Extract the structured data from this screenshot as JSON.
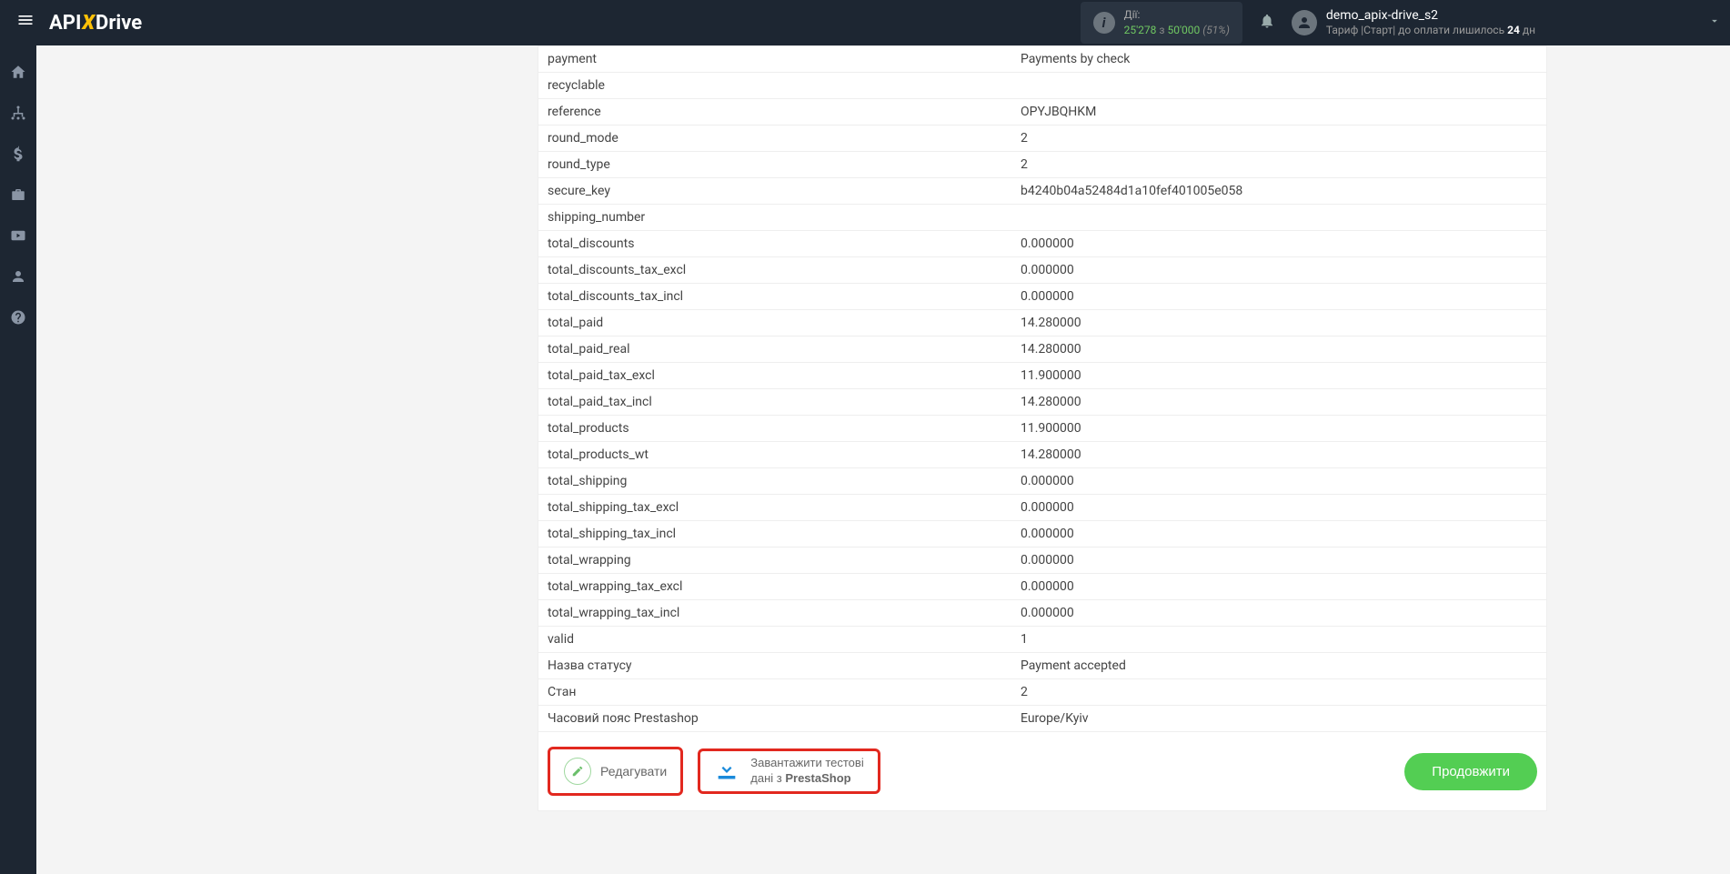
{
  "header": {
    "logo_part1": "API",
    "logo_x": "X",
    "logo_part2": "Drive",
    "stats": {
      "label": "Дії:",
      "used": "25'278",
      "sep": " з ",
      "total": "50'000",
      "pct": " (51%)"
    },
    "user": {
      "name": "demo_apix-drive_s2",
      "tariff_prefix": "Тариф |Старт| до оплати лишилось ",
      "days": "24",
      "tariff_suffix": " дн"
    }
  },
  "rows": [
    {
      "key": "payment",
      "value": "Payments by check"
    },
    {
      "key": "recyclable",
      "value": ""
    },
    {
      "key": "reference",
      "value": "OPYJBQHKM"
    },
    {
      "key": "round_mode",
      "value": "2"
    },
    {
      "key": "round_type",
      "value": "2"
    },
    {
      "key": "secure_key",
      "value": "b4240b04a52484d1a10fef401005e058"
    },
    {
      "key": "shipping_number",
      "value": ""
    },
    {
      "key": "total_discounts",
      "value": "0.000000"
    },
    {
      "key": "total_discounts_tax_excl",
      "value": "0.000000"
    },
    {
      "key": "total_discounts_tax_incl",
      "value": "0.000000"
    },
    {
      "key": "total_paid",
      "value": "14.280000"
    },
    {
      "key": "total_paid_real",
      "value": "14.280000"
    },
    {
      "key": "total_paid_tax_excl",
      "value": "11.900000"
    },
    {
      "key": "total_paid_tax_incl",
      "value": "14.280000"
    },
    {
      "key": "total_products",
      "value": "11.900000"
    },
    {
      "key": "total_products_wt",
      "value": "14.280000"
    },
    {
      "key": "total_shipping",
      "value": "0.000000"
    },
    {
      "key": "total_shipping_tax_excl",
      "value": "0.000000"
    },
    {
      "key": "total_shipping_tax_incl",
      "value": "0.000000"
    },
    {
      "key": "total_wrapping",
      "value": "0.000000"
    },
    {
      "key": "total_wrapping_tax_excl",
      "value": "0.000000"
    },
    {
      "key": "total_wrapping_tax_incl",
      "value": "0.000000"
    },
    {
      "key": "valid",
      "value": "1"
    },
    {
      "key": "Назва статусу",
      "value": "Payment accepted"
    },
    {
      "key": "Стан",
      "value": "2"
    },
    {
      "key": "Часовий пояс Prestashop",
      "value": "Europe/Kyiv"
    }
  ],
  "actions": {
    "edit": "Редагувати",
    "download_line1": "Завантажити тестові",
    "download_line2_prefix": "дані з ",
    "download_line2_bold": "PrestaShop",
    "continue": "Продовжити"
  }
}
